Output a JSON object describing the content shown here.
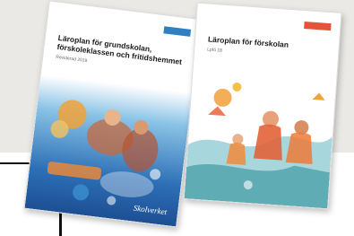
{
  "books": [
    {
      "title": "Läroplan för grundskolan,\nförskoleklassen och fritidshemmet",
      "subtitle": "Reviderad 2019",
      "publisher": "Skolverket",
      "tag_color": "#2f7fc1"
    },
    {
      "title": "Läroplan för förskolan",
      "subtitle": "Lpfö 18",
      "tag_color": "#e2553a"
    }
  ]
}
